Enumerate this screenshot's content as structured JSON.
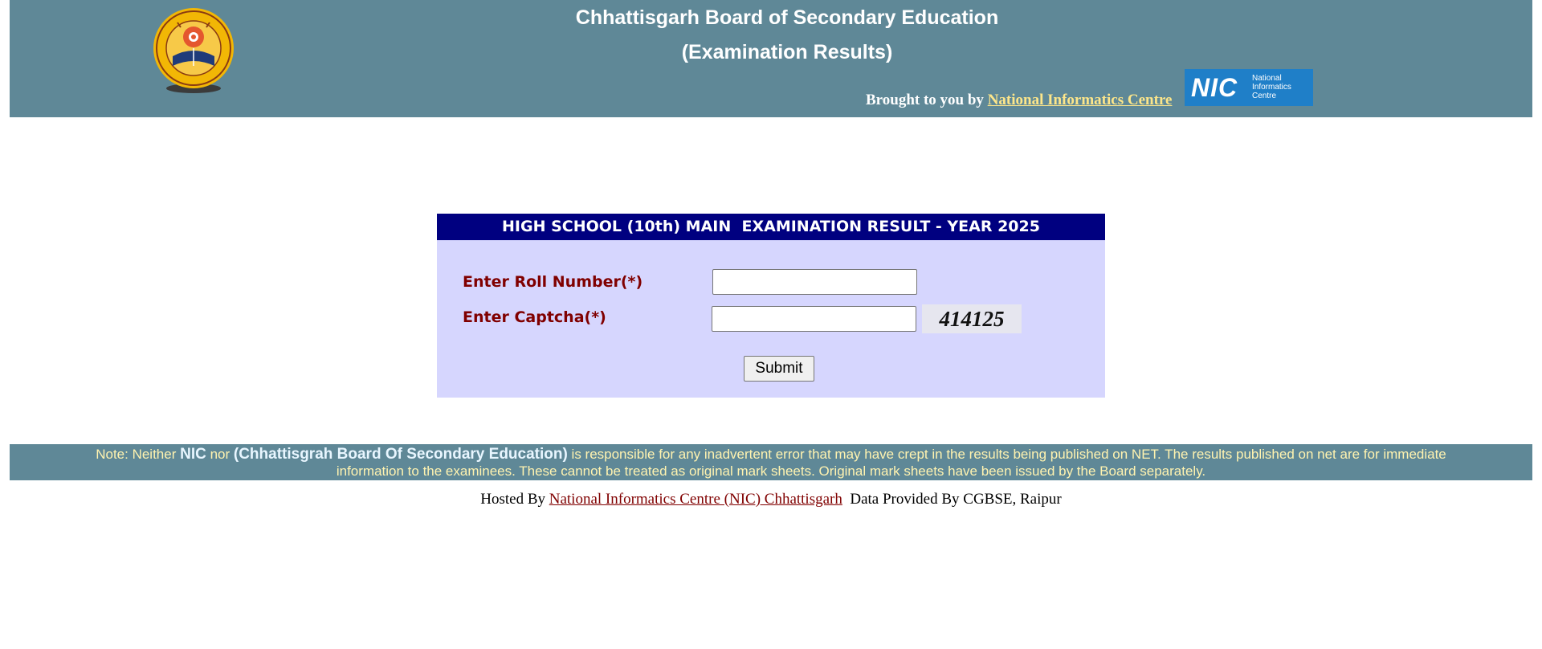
{
  "header": {
    "title": "Chhattisgarh Board of Secondary Education",
    "subtitle": "(Examination Results)",
    "brought_prefix": "Brought to you by ",
    "brought_link": "National Informatics Centre",
    "nic_logo_mark": "NIC",
    "nic_logo_line1": "National",
    "nic_logo_line2": "Informatics",
    "nic_logo_line3": "Centre",
    "colors": {
      "bar": "#5f8897",
      "link": "#fde68a"
    }
  },
  "form": {
    "heading": "HIGH SCHOOL (10th) MAIN  EXAMINATION RESULT - YEAR 2025",
    "roll_label": "Enter Roll Number(*)",
    "roll_value": "",
    "captcha_label": "Enter Captcha(*)",
    "captcha_value": "",
    "captcha_code": "414125",
    "submit_label": "Submit",
    "colors": {
      "heading_bg": "#000080",
      "box_bg": "#d6d6fe",
      "label": "#800000"
    }
  },
  "note": {
    "p1": "Note: Neither ",
    "nic": "NIC",
    "p2": " nor ",
    "board": "(Chhattisgrah Board Of Secondary Education)",
    "p3": " is responsible for any inadvertent error that may have crept in the results being published on NET. The results published on net are for immediate information to the examinees. These cannot be treated as original mark sheets. Original mark sheets have been issued by the Board separately."
  },
  "footer": {
    "hosted_prefix": "Hosted By ",
    "hosted_link": "National Informatics Centre (NIC) Chhattisgarh",
    "data_text": "  Data Provided By CGBSE, Raipur"
  }
}
